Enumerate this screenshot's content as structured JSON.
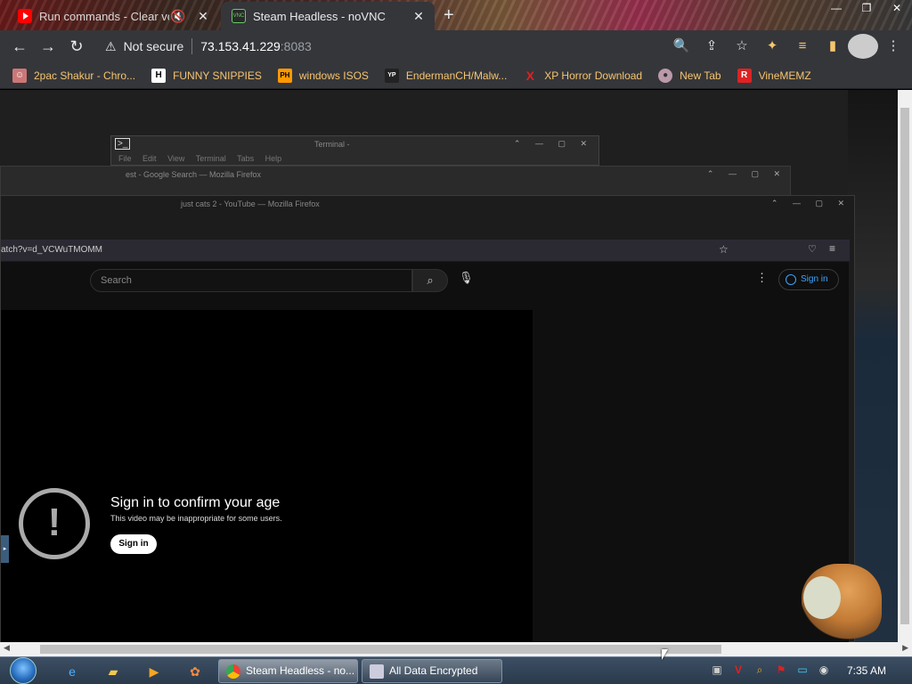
{
  "browser": {
    "tabs": [
      {
        "title": "Run commands - Clear vo",
        "active": false
      },
      {
        "title": "Steam Headless - noVNC",
        "active": true
      }
    ],
    "address": {
      "security": "Not secure",
      "host": "73.153.41.229",
      "port": ":8083"
    }
  },
  "bookmarks": [
    {
      "label": "2pac Shakur - Chro...",
      "icon": "person-icon",
      "mark": ""
    },
    {
      "label": "FUNNY SNIPPIES",
      "icon": "h-icon",
      "mark": "H"
    },
    {
      "label": "windows ISOS",
      "icon": "ph-icon",
      "mark": "PH"
    },
    {
      "label": "EndermanCH/Malw...",
      "icon": "yp-icon",
      "mark": "YP"
    },
    {
      "label": "XP Horror Download",
      "icon": "x-icon",
      "mark": "X"
    },
    {
      "label": "New Tab",
      "icon": "globe-icon",
      "mark": ""
    },
    {
      "label": "VineMEMZ",
      "icon": "r-icon",
      "mark": "R"
    }
  ],
  "remote": {
    "terminal": {
      "title": "Terminal -",
      "menu": [
        "File",
        "Edit",
        "View",
        "Terminal",
        "Tabs",
        "Help"
      ]
    },
    "firefox_back": {
      "title": "est - Google Search — Mozilla Firefox"
    },
    "firefox_front": {
      "title": "just cats 2 - YouTube — Mozilla Firefox",
      "url": "atch?v=d_VCWuTMOMM"
    },
    "youtube": {
      "search_placeholder": "Search",
      "signin_label": "Sign in",
      "age_gate": {
        "title": "Sign in to confirm your age",
        "subtitle": "This video may be inappropriate for some users.",
        "button": "Sign in"
      }
    }
  },
  "taskbar": {
    "items": [
      {
        "label": "Steam Headless - no...",
        "active": true
      },
      {
        "label": "All Data Encrypted",
        "active": false
      }
    ],
    "clock": "7:35 AM"
  },
  "colors": {
    "bookmark_text": "#f6c56e",
    "youtube_link": "#3ea6ff"
  }
}
